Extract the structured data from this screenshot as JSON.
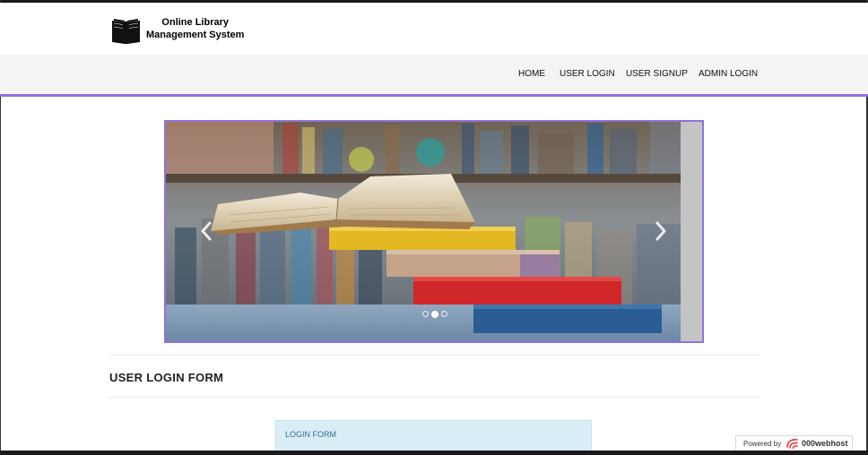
{
  "header": {
    "brand_line1": "Online Library",
    "brand_line2": "Management System",
    "logo_icon": "open-book-icon"
  },
  "nav": {
    "home": "HOME",
    "user_login": "USER LOGIN",
    "user_signup": "USER SIGNUP",
    "admin_login": "ADMIN LOGIN",
    "accent_color": "#9370db"
  },
  "carousel": {
    "slide_count": 3,
    "active_index": 1,
    "prev_icon": "chevron-left-icon",
    "next_icon": "chevron-right-icon"
  },
  "page": {
    "form_title": "USER LOGIN FORM",
    "panel_heading": "LOGIN FORM"
  },
  "footer_badge": {
    "powered_by": "Powered by",
    "host_name": "000webhost",
    "logo_icon": "000webhost-logo-icon"
  }
}
